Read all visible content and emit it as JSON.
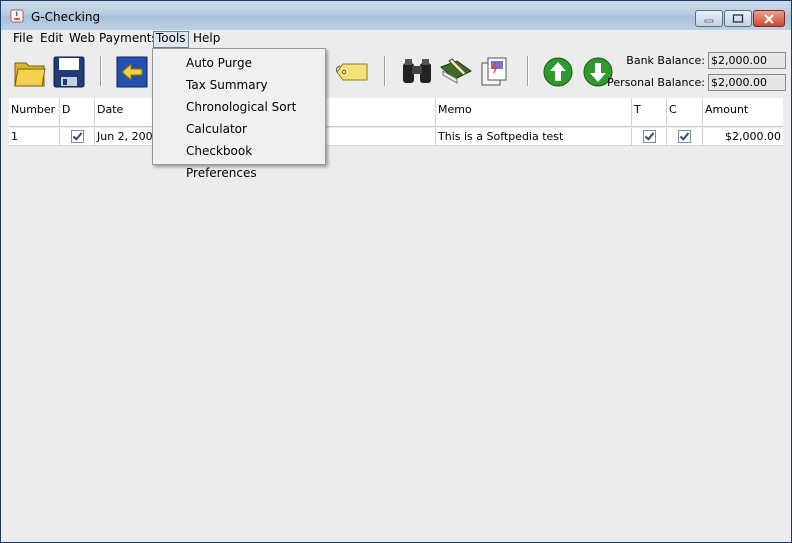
{
  "window": {
    "title": "G-Checking"
  },
  "menubar": [
    {
      "label": "File"
    },
    {
      "label": "Edit"
    },
    {
      "label": "Web Payments"
    },
    {
      "label": "Tools"
    },
    {
      "label": "Help"
    }
  ],
  "tools_menu": [
    {
      "label": "Auto Purge"
    },
    {
      "label": "Tax Summary"
    },
    {
      "label": "Chronological Sort"
    },
    {
      "label": "Calculator"
    },
    {
      "label": "Checkbook Preferences"
    }
  ],
  "balances": {
    "bank_label": "Bank Balance:",
    "bank_value": "$2,000.00",
    "personal_label": "Personal Balance:",
    "personal_value": "$2,000.00"
  },
  "table": {
    "headers": [
      "Number",
      "D",
      "Date",
      "Memo",
      "T",
      "C",
      "Amount"
    ],
    "rows": [
      {
        "number": "1",
        "d": true,
        "date": "Jun 2, 2009",
        "memo": "This is a Softpedia test",
        "t": true,
        "c": true,
        "amount": "$2,000.00"
      }
    ]
  },
  "colors": {
    "accent_green": "#2e9a2e",
    "folder_yellow": "#f1d24a",
    "disk_navy": "#1e3c78",
    "arrow_blue": "#2450b0"
  }
}
